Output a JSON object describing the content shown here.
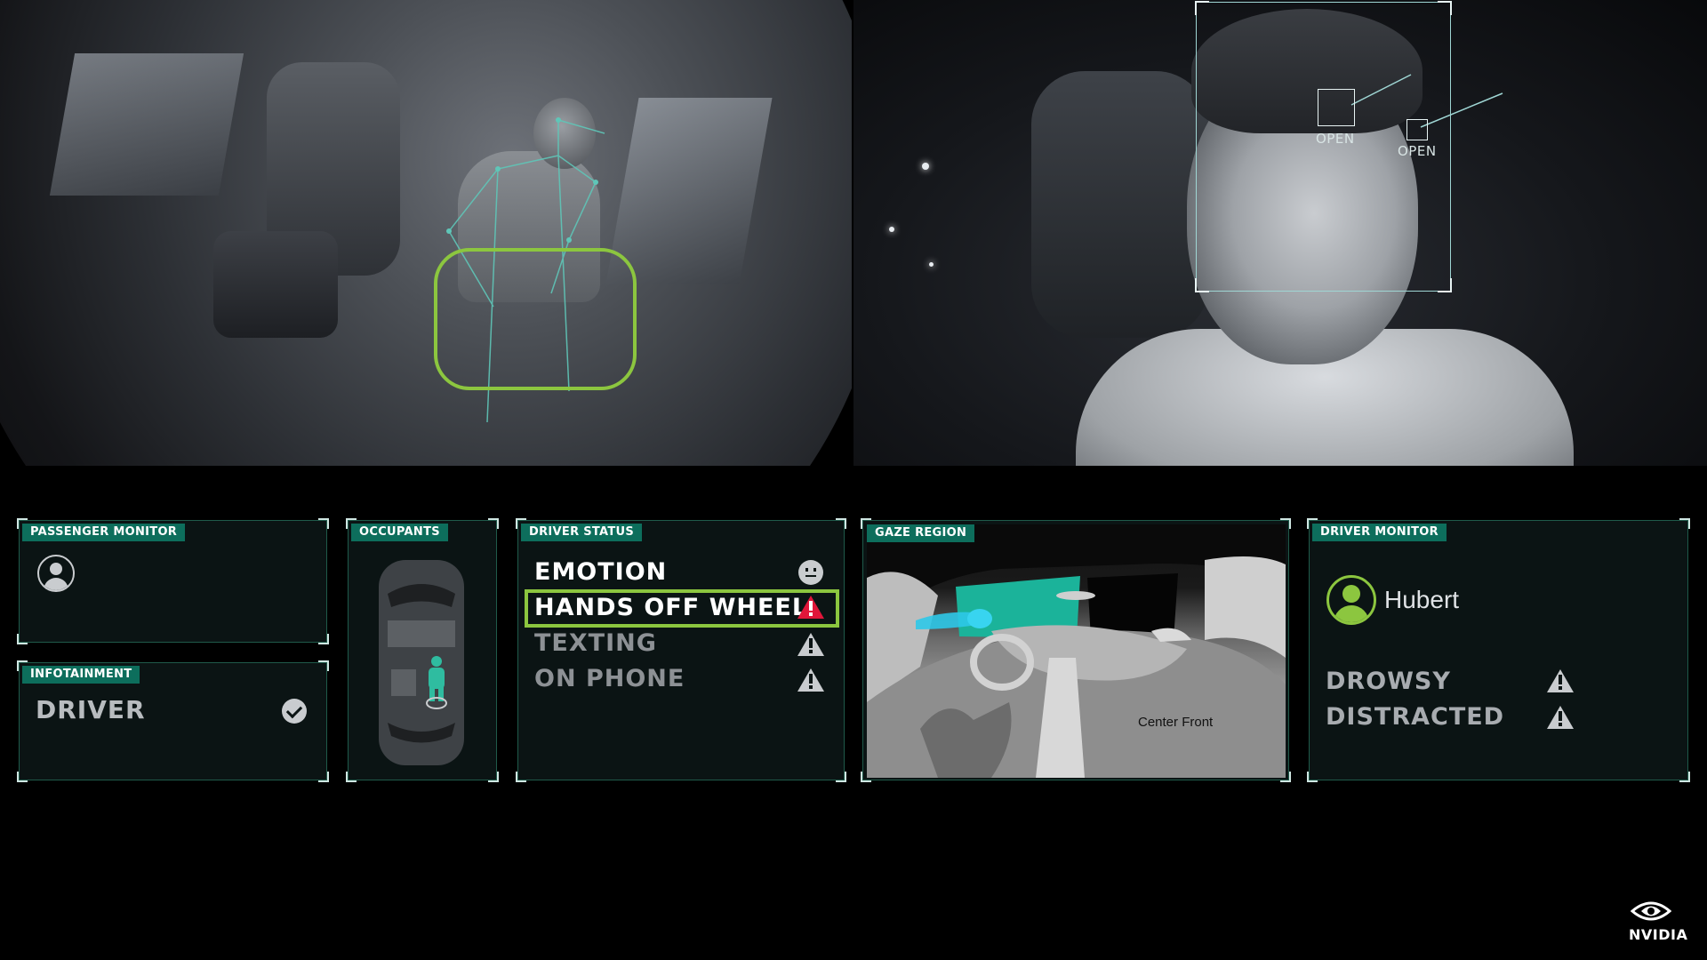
{
  "cabin_feed": {
    "detection": "hands-off-wheel"
  },
  "driver_feed": {
    "left_eye_label": "OPEN",
    "right_eye_label": "OPEN"
  },
  "passenger_monitor": {
    "title": "PASSENGER MONITOR",
    "icon": "user-outline-icon"
  },
  "infotainment": {
    "title": "INFOTAINMENT",
    "value": "DRIVER",
    "icon": "check-circle-icon"
  },
  "occupants": {
    "title": "OCCUPANTS",
    "icon": "car-topview-icon"
  },
  "driver_status": {
    "title": "DRIVER STATUS",
    "items": [
      {
        "label": "EMOTION",
        "icon": "neutral-face-icon",
        "active": true,
        "alert": false
      },
      {
        "label": "HANDS OFF WHEEL",
        "icon": "warning-icon",
        "active": true,
        "alert": true
      },
      {
        "label": "TEXTING",
        "icon": "warning-icon",
        "active": false,
        "alert": false
      },
      {
        "label": "ON PHONE",
        "icon": "warning-icon",
        "active": false,
        "alert": false
      }
    ],
    "highlight_color": "#8cc63f",
    "alert_color": "#e0163a"
  },
  "gaze_region": {
    "title": "GAZE REGION",
    "region_label": "Center Front"
  },
  "driver_monitor": {
    "title": "DRIVER MONITOR",
    "user_name": "Hubert",
    "states": [
      {
        "label": "DROWSY",
        "icon": "warning-icon"
      },
      {
        "label": "DISTRACTED",
        "icon": "warning-icon"
      }
    ]
  },
  "brand": {
    "name": "NVIDIA",
    "accent": "#76b900",
    "panel_tag_color": "#0d6e5c"
  }
}
